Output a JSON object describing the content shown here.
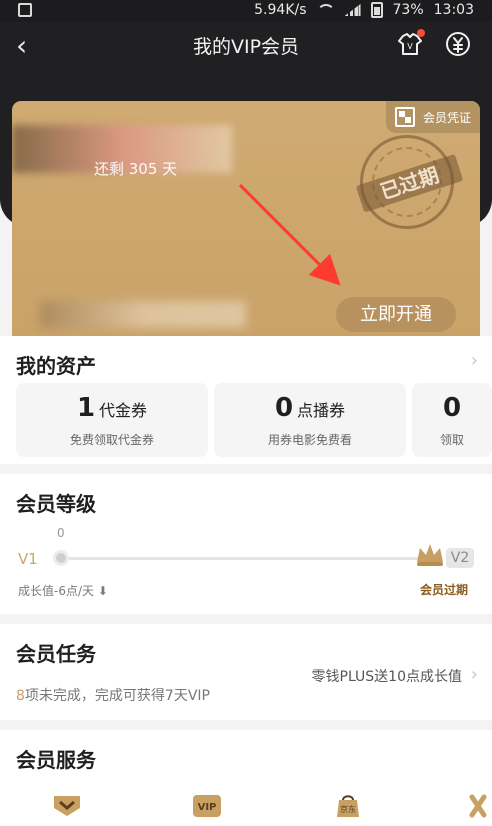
{
  "statusbar": {
    "speed": "5.94K/s",
    "battery": "73%",
    "time": "13:03"
  },
  "header": {
    "title": "我的VIP会员"
  },
  "card": {
    "days": "还剩 305 天",
    "voucher_label": "会员凭证",
    "stamp_text": "已过期",
    "open_button": "立即开通"
  },
  "assets": {
    "title": "我的资产",
    "items": [
      {
        "count": "1",
        "unit": "代金券",
        "desc": "免费领取代金券"
      },
      {
        "count": "0",
        "unit": "点播券",
        "desc": "用券电影免费看"
      },
      {
        "count": "0",
        "unit": "",
        "desc": "领取"
      }
    ]
  },
  "level": {
    "title": "会员等级",
    "v1": "V1",
    "v2": "V2",
    "progress_value": "0",
    "growth": "成长值-6点/天",
    "status": "会员过期"
  },
  "tasks": {
    "title": "会员任务",
    "link": "零钱PLUS送10点成长值",
    "count": "8",
    "hint": "项未完成，完成可获得7天VIP"
  },
  "services": {
    "title": "会员服务",
    "icons": [
      "vip-badge-icon",
      "vip-icon",
      "jd-bag-icon",
      "ribbon-icon"
    ]
  },
  "colors": {
    "gold": "#c9a267",
    "dark": "#202022",
    "expired": "#8a5c1f"
  }
}
